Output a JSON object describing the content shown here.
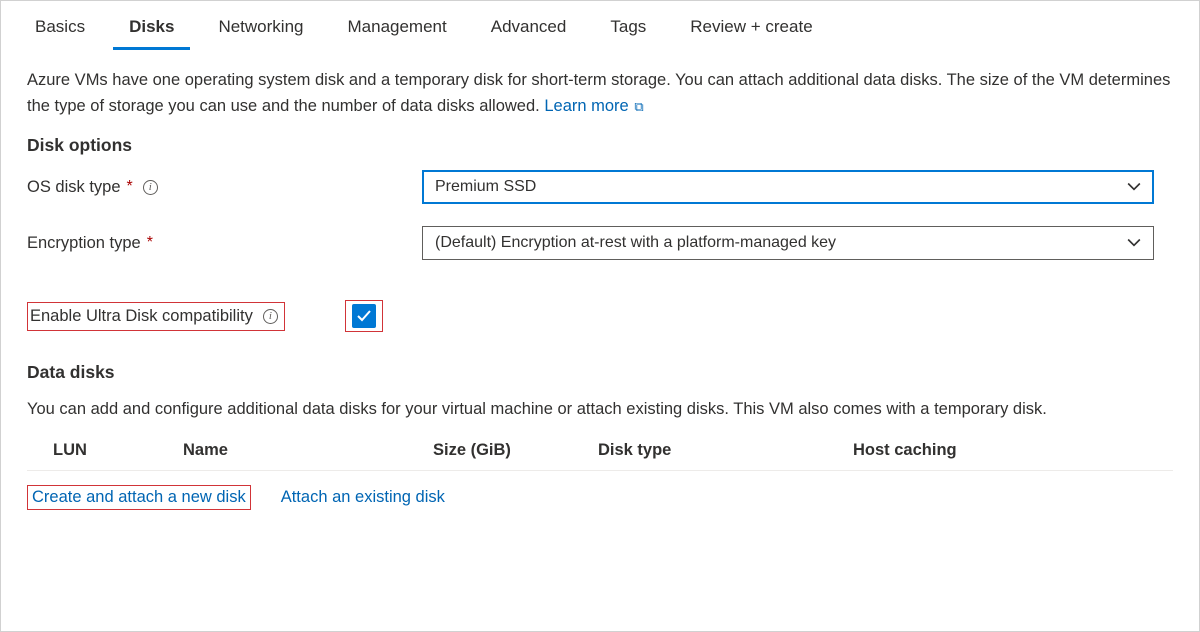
{
  "tabs": [
    {
      "label": "Basics",
      "active": false
    },
    {
      "label": "Disks",
      "active": true
    },
    {
      "label": "Networking",
      "active": false
    },
    {
      "label": "Management",
      "active": false
    },
    {
      "label": "Advanced",
      "active": false
    },
    {
      "label": "Tags",
      "active": false
    },
    {
      "label": "Review + create",
      "active": false
    }
  ],
  "intro": "Azure VMs have one operating system disk and a temporary disk for short-term storage. You can attach additional data disks. The size of the VM determines the type of storage you can use and the number of data disks allowed.",
  "learn_more": "Learn more",
  "section_disk_options": "Disk options",
  "fields": {
    "os_disk_type": {
      "label": "OS disk type",
      "value": "Premium SSD",
      "required": true,
      "has_info": true,
      "focused": true
    },
    "encryption_type": {
      "label": "Encryption type",
      "value": "(Default) Encryption at-rest with a platform-managed key",
      "required": true,
      "has_info": false,
      "focused": false
    },
    "ultra_disk": {
      "label": "Enable Ultra Disk compatibility",
      "checked": true,
      "has_info": true
    }
  },
  "section_data_disks": "Data disks",
  "data_disks_intro": "You can add and configure additional data disks for your virtual machine or attach existing disks. This VM also comes with a temporary disk.",
  "table_headers": {
    "lun": "LUN",
    "name": "Name",
    "size": "Size (GiB)",
    "disk_type": "Disk type",
    "host_caching": "Host caching"
  },
  "actions": {
    "create_attach": "Create and attach a new disk",
    "attach_existing": "Attach an existing disk"
  }
}
